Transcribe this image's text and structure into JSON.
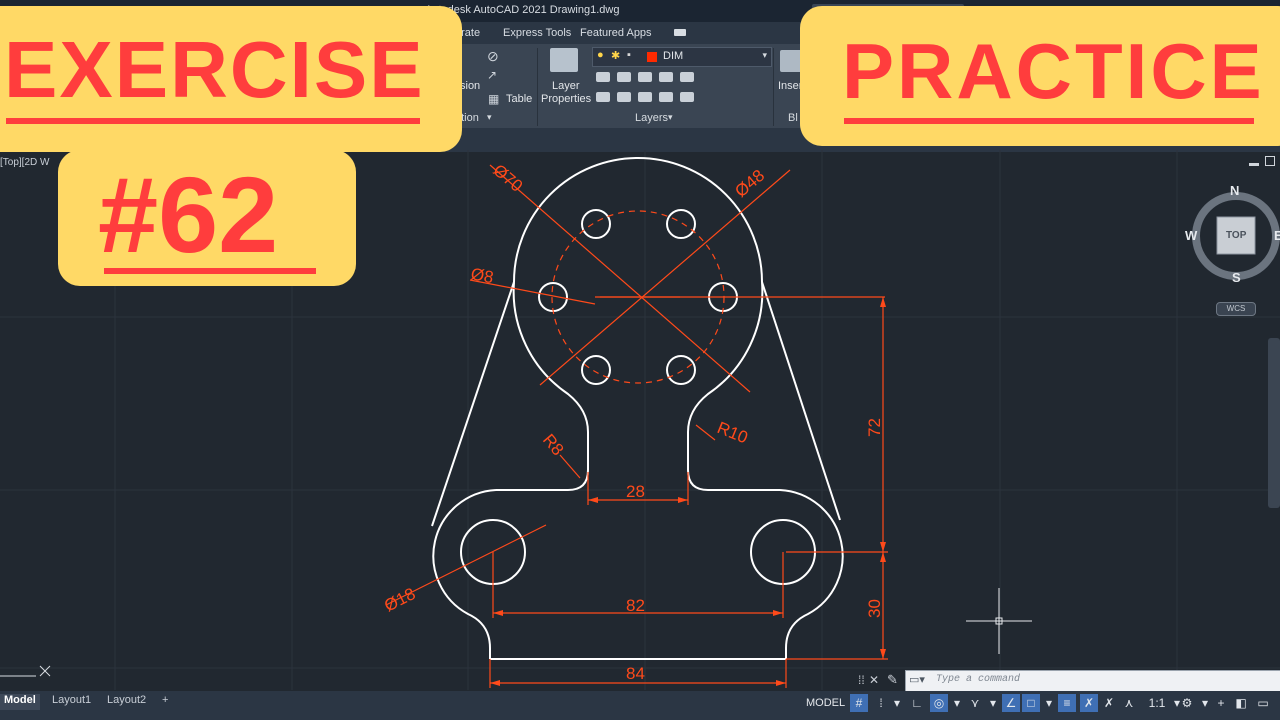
{
  "window": {
    "title": "Autodesk AutoCAD 2021    Drawing1.dwg"
  },
  "ribbon_tabs": [
    "orate",
    "Express Tools",
    "Featured Apps"
  ],
  "ribbon": {
    "annotation_panel": {
      "dimension_label": "sion",
      "table_label": "Table",
      "footer": "ation"
    },
    "layers_panel": {
      "layer_properties_line1": "Layer",
      "layer_properties_line2": "Properties",
      "current_layer": "DIM",
      "footer": "Layers"
    },
    "block_panel": {
      "insert_label": "Inser",
      "footer": "Bl"
    }
  },
  "viewport": {
    "label": "[Top][2D W"
  },
  "view_cube": {
    "north": "N",
    "south": "S",
    "east": "E",
    "west": "W",
    "face": "TOP",
    "wcs": "WCS"
  },
  "banners": {
    "exercise": "EXERCISE",
    "number": "#62",
    "practice": "PRACTICE"
  },
  "dimensions": {
    "d70": "Ø70",
    "d48": "Ø48",
    "d8": "Ø8",
    "r8": "R8",
    "r10": "R10",
    "w28": "28",
    "h72": "72",
    "d18": "Ø18",
    "w82": "82",
    "h30": "30",
    "w84": "84"
  },
  "layout_tabs": {
    "model": "Model",
    "layout1": "Layout1",
    "layout2": "Layout2",
    "add": "+"
  },
  "command_line": {
    "placeholder": "Type a command"
  },
  "status_bar": {
    "model": "MODEL",
    "scale": "1:1"
  },
  "colors": {
    "background": "#212830",
    "dimension": "#ff4a1a",
    "geometry": "#ffffff",
    "banner": "#ffd966",
    "banner_text": "#ff3d3d"
  }
}
